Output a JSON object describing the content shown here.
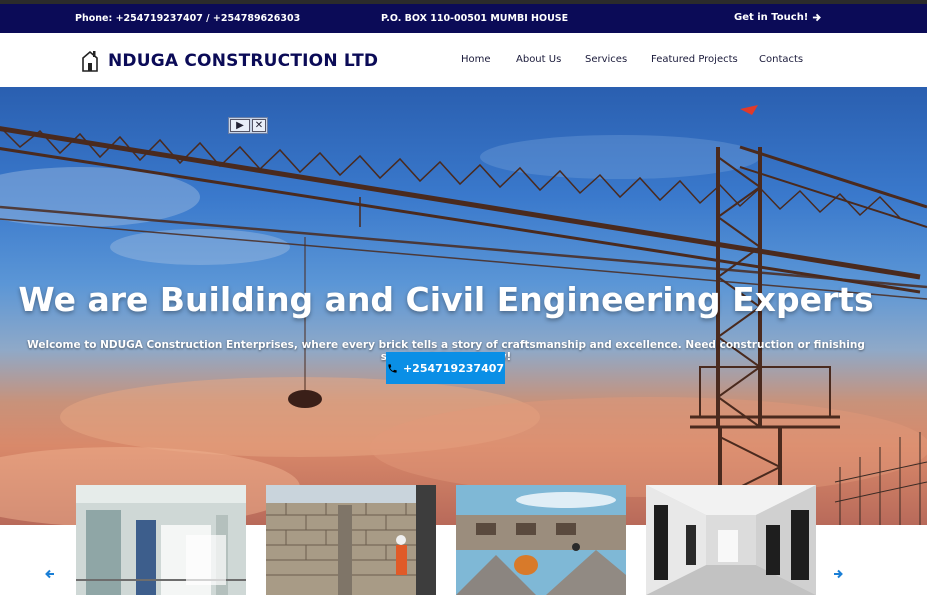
{
  "topbar": {
    "phone": "Phone: +254719237407 / +254789626303",
    "address": "P.O. BOX 110-00501 MUMBI HOUSE",
    "get_in_touch": "Get in Touch!",
    "get_in_touch_icon": "arrow-right-icon"
  },
  "header": {
    "brand_prefix": "NDUGA",
    "brand_suffix": " CONSTRUCTION LTD",
    "logo_icon": "house-icon",
    "brand_color": "#0b0b57",
    "menu": [
      "Home",
      "About Us",
      "Services",
      "Featured Projects",
      "Contacts"
    ]
  },
  "hero": {
    "title": "We are Building and Civil Engineering Experts",
    "subtitle": "Welcome to NDUGA Construction Enterprises, where every brick tells a story of craftsmanship and excellence. Need construction or finishing services? Call us now!",
    "call_button": "+254719237407",
    "call_icon": "phone-icon",
    "accent_color": "#0a8fe6",
    "ad_controls": [
      "play-icon",
      "close-icon"
    ]
  },
  "carousel": {
    "prev_icon": "arrow-left-icon",
    "next_icon": "arrow-right-icon",
    "items": [
      "corridor-building",
      "brick-wall-worker",
      "concrete-mixer-site",
      "modern-interior-hallway"
    ]
  }
}
